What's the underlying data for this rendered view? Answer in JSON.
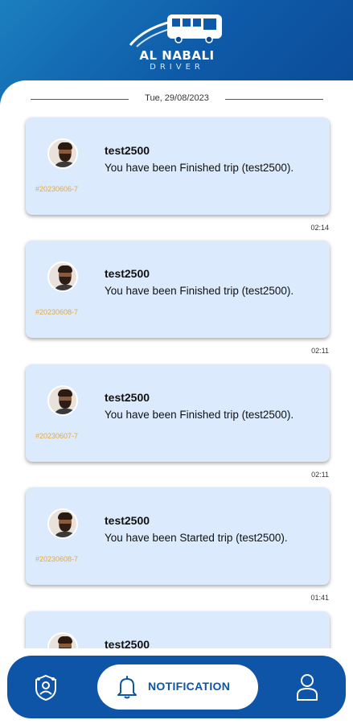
{
  "app": {
    "brand_title": "AL NABALI",
    "brand_subtitle": "DRIVER"
  },
  "date_separator": "Tue, 29/08/2023",
  "notifications": [
    {
      "trip_id": "#20230606-7",
      "title": "test2500",
      "message": "You have been Finished trip (test2500).",
      "time": "02:14"
    },
    {
      "trip_id": "#20230608-7",
      "title": "test2500",
      "message": "You have been Finished trip (test2500).",
      "time": "02:11"
    },
    {
      "trip_id": "#20230607-7",
      "title": "test2500",
      "message": "You have been Finished trip (test2500).",
      "time": "02:11"
    },
    {
      "trip_id": "#20230608-7",
      "title": "test2500",
      "message": "You have been Started trip (test2500).",
      "time": "01:41"
    },
    {
      "trip_id": "",
      "title": "test2500",
      "message": "",
      "time": ""
    }
  ],
  "bottom_nav": {
    "items": [
      {
        "icon": "driver-badge-icon"
      },
      {
        "icon": "bell-icon",
        "label": "NOTIFICATION",
        "active": true
      },
      {
        "icon": "user-icon"
      }
    ]
  },
  "colors": {
    "primary": "#0f55a7",
    "card_bg": "#dbeafd",
    "trip_id": "#e7a93c"
  }
}
